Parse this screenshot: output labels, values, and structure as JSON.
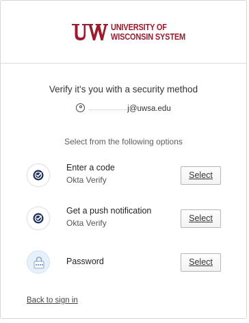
{
  "header": {
    "logo_line1": "UNIVERSITY OF",
    "logo_line2": "WISCONSIN SYSTEM",
    "brand_color": "#9b1c2e"
  },
  "title": "Verify it's you with a security method",
  "identity": {
    "icon": "user-icon",
    "email_suffix": "j@uwsa.edu"
  },
  "subtitle": "Select from the following options",
  "options": [
    {
      "label": "Enter a code",
      "sub": "Okta Verify",
      "icon": "okta-verify-icon",
      "button": "Select"
    },
    {
      "label": "Get a push notification",
      "sub": "Okta Verify",
      "icon": "okta-verify-icon",
      "button": "Select"
    },
    {
      "label": "Password",
      "sub": "",
      "icon": "password-icon",
      "button": "Select"
    }
  ],
  "back_link": "Back to sign in"
}
